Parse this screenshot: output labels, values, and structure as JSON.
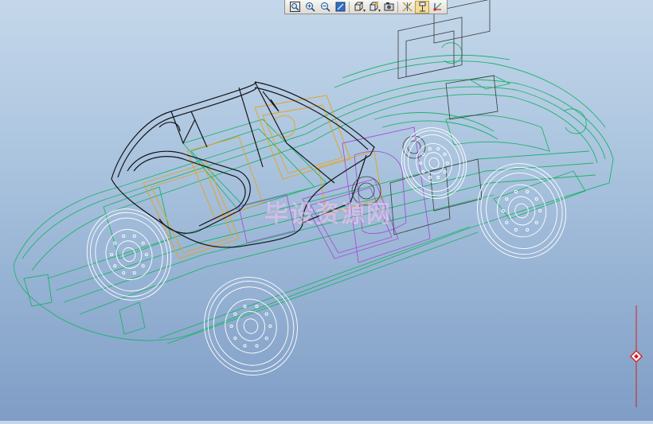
{
  "toolbar": {
    "tools": [
      {
        "name": "zoom-fit",
        "icon": "zoom-fit-icon"
      },
      {
        "name": "zoom-in",
        "icon": "zoom-in-icon"
      },
      {
        "name": "zoom-out",
        "icon": "zoom-out-icon"
      },
      {
        "name": "repaint",
        "icon": "repaint-icon"
      },
      {
        "name": "display-style",
        "icon": "display-style-icon",
        "dropdown": true
      },
      {
        "name": "saved-views",
        "icon": "saved-views-icon",
        "dropdown": true
      },
      {
        "name": "view-manager",
        "icon": "view-manager-icon"
      },
      {
        "name": "datum-display",
        "icon": "datum-display-icon"
      },
      {
        "name": "annotation-display",
        "icon": "annotation-display-icon",
        "active": true
      },
      {
        "name": "spin-center",
        "icon": "spin-center-icon"
      }
    ]
  },
  "model": {
    "watermark": "毕设资源网",
    "colors": {
      "background_top": "#c4d7ea",
      "background_bottom": "#7f9dc6",
      "body_wireframe": "#1db36a",
      "top_frame": "#15151a",
      "seats": "#e8a218",
      "interior": "#a64fd8",
      "wheels": "#ffffff",
      "dragger_line": "#d32020"
    }
  }
}
